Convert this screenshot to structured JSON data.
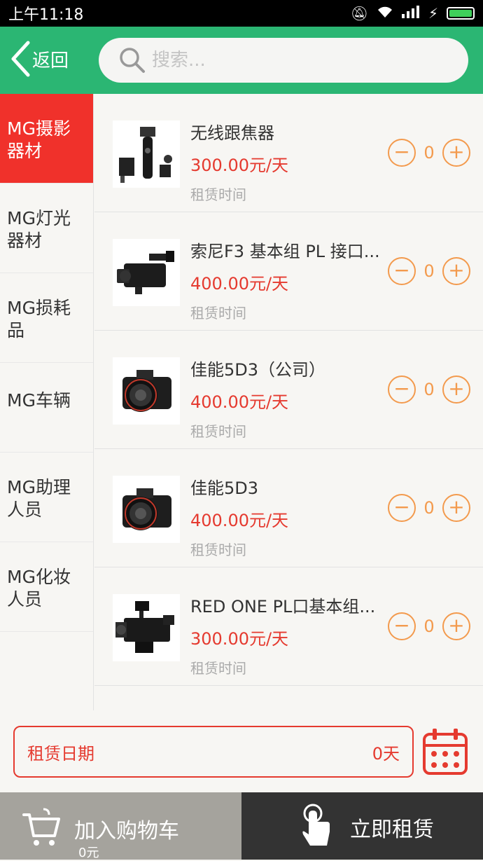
{
  "status_bar": {
    "time": "上午11:18"
  },
  "header": {
    "back_label": "返回",
    "search_placeholder": "搜索..."
  },
  "categories": [
    {
      "label": "MG摄影器材",
      "active": true
    },
    {
      "label": "MG灯光器材",
      "active": false
    },
    {
      "label": "MG损耗品",
      "active": false
    },
    {
      "label": "MG车辆",
      "active": false
    },
    {
      "label": "MG助理人员",
      "active": false
    },
    {
      "label": "MG化妆人员",
      "active": false
    }
  ],
  "products": [
    {
      "name": "无线跟焦器",
      "price": "300.00元/天",
      "rent_label": "租赁时间",
      "qty": "0",
      "image": "follow-focus"
    },
    {
      "name": "索尼F3 基本组 PL 接口...",
      "price": "400.00元/天",
      "rent_label": "租赁时间",
      "qty": "0",
      "image": "camcorder"
    },
    {
      "name": "佳能5D3（公司）",
      "price": "400.00元/天",
      "rent_label": "租赁时间",
      "qty": "0",
      "image": "dslr"
    },
    {
      "name": "佳能5D3",
      "price": "400.00元/天",
      "rent_label": "租赁时间",
      "qty": "0",
      "image": "dslr"
    },
    {
      "name": "RED ONE PL口基本组...",
      "price": "300.00元/天",
      "rent_label": "租赁时间",
      "qty": "0",
      "image": "cinema-camera"
    }
  ],
  "date_bar": {
    "label": "租赁日期",
    "days": "0天"
  },
  "footer": {
    "cart_label": "加入购物车",
    "cart_total": "0元",
    "rent_label": "立即租赁"
  },
  "colors": {
    "header": "#2bb673",
    "accent": "#f0312b",
    "price": "#e53a2f",
    "stepper": "#f39a4d"
  }
}
